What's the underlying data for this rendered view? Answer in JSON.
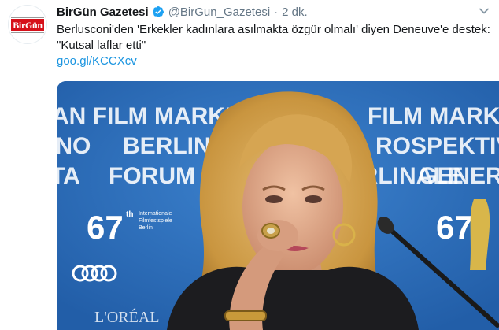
{
  "tweet": {
    "author_name": "BirGün Gazetesi",
    "handle": "@BirGun_Gazetesi",
    "separator": "·",
    "time": "2 dk.",
    "text_line1": "Berlusconi'den 'Erkekler kadınlara asılmakta özgür olmalı' diyen Deneuve'e destek:",
    "text_line2": "\"Kutsal laflar etti\"",
    "link": "goo.gl/KCCXcv",
    "avatar_logo": "BirGün",
    "verified_icon": "verified-badge-icon",
    "menu_icon": "chevron-down-icon"
  },
  "photo": {
    "backdrop_rows": [
      [
        "AN FILM MARKET",
        "FILM MARKET"
      ],
      [
        "INO",
        "BERLINALE",
        "ROSPEKTIVE"
      ],
      [
        "TA",
        "FORUM",
        "BERLINALE",
        "GENERATI"
      ]
    ],
    "badge_number": "67",
    "badge_sup": "th",
    "badge_caption": [
      "Internationale",
      "Filmfestspiele",
      "Berlin"
    ],
    "sponsor": "L'ORÉAL",
    "audi": "audi"
  },
  "colors": {
    "link": "#1b95e0",
    "verified": "#1da1f2",
    "brand_red": "#d6101a",
    "backdrop_blue": "#2f6fb9",
    "text_primary": "#14171a",
    "text_secondary": "#657786"
  }
}
